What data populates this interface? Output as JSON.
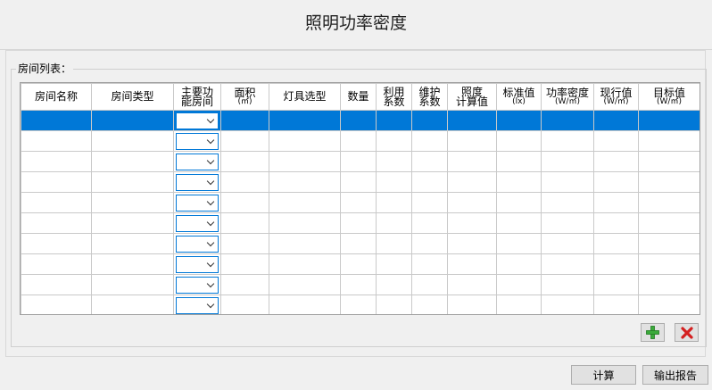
{
  "window": {
    "title": "照明功率密度"
  },
  "group": {
    "label": "房间列表："
  },
  "table": {
    "columns": [
      {
        "line1": "房间名称",
        "line2": ""
      },
      {
        "line1": "房间类型",
        "line2": ""
      },
      {
        "line1": "主要功",
        "line2": "能房间"
      },
      {
        "line1": "面积",
        "line2": "(㎡)"
      },
      {
        "line1": "灯具选型",
        "line2": ""
      },
      {
        "line1": "数量",
        "line2": ""
      },
      {
        "line1": "利用",
        "line2": "系数"
      },
      {
        "line1": "维护",
        "line2": "系数"
      },
      {
        "line1": "照度",
        "line2": "计算值"
      },
      {
        "line1": "标准值",
        "line2": "(lx)"
      },
      {
        "line1": "功率密度",
        "line2": "(W/㎡)"
      },
      {
        "line1": "现行值",
        "line2": "(W/㎡)"
      },
      {
        "line1": "目标值",
        "line2": "(W/㎡)"
      }
    ],
    "row_count": 10,
    "selected_row": 0
  },
  "buttons": {
    "calculate": "计算",
    "export_report": "输出报告"
  },
  "icons": {
    "add": "plus-icon",
    "delete": "close-icon"
  },
  "colors": {
    "selection": "#0078d7",
    "add_icon": "#2e9e2e",
    "delete_icon": "#d42020"
  }
}
